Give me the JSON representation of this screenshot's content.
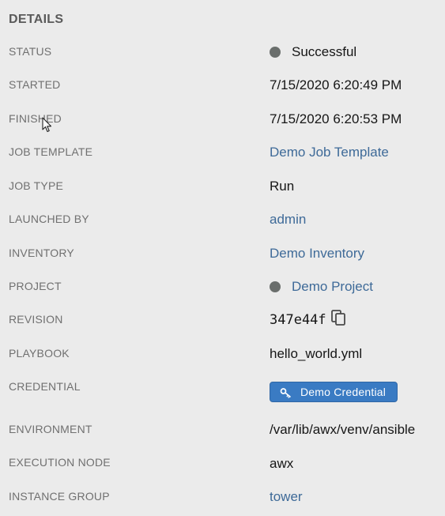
{
  "section_title": "DETAILS",
  "status": {
    "label": "STATUS",
    "value": "Successful",
    "indicator_color": "#6a6e6c"
  },
  "started": {
    "label": "STARTED",
    "value": "7/15/2020 6:20:49 PM"
  },
  "finished": {
    "label": "FINISHED",
    "value": "7/15/2020 6:20:53 PM"
  },
  "job_template": {
    "label": "JOB TEMPLATE",
    "value": "Demo Job Template"
  },
  "job_type": {
    "label": "JOB TYPE",
    "value": "Run"
  },
  "launched_by": {
    "label": "LAUNCHED BY",
    "value": "admin"
  },
  "inventory": {
    "label": "INVENTORY",
    "value": "Demo Inventory"
  },
  "project": {
    "label": "PROJECT",
    "value": "Demo Project",
    "indicator_color": "#6a6e6c"
  },
  "revision": {
    "label": "REVISION",
    "value": "347e44f",
    "icon": "copy-icon"
  },
  "playbook": {
    "label": "PLAYBOOK",
    "value": "hello_world.yml"
  },
  "credential": {
    "label": "CREDENTIAL",
    "value": "Demo Credential",
    "icon": "key-icon",
    "chip_color": "#3a7bc3"
  },
  "environment": {
    "label": "ENVIRONMENT",
    "value": "/var/lib/awx/venv/ansible"
  },
  "execution_node": {
    "label": "EXECUTION NODE",
    "value": "awx"
  },
  "instance_group": {
    "label": "INSTANCE GROUP",
    "value": "tower"
  },
  "colors": {
    "link": "#3e6a98",
    "label": "#707070",
    "background": "#ebebeb"
  }
}
